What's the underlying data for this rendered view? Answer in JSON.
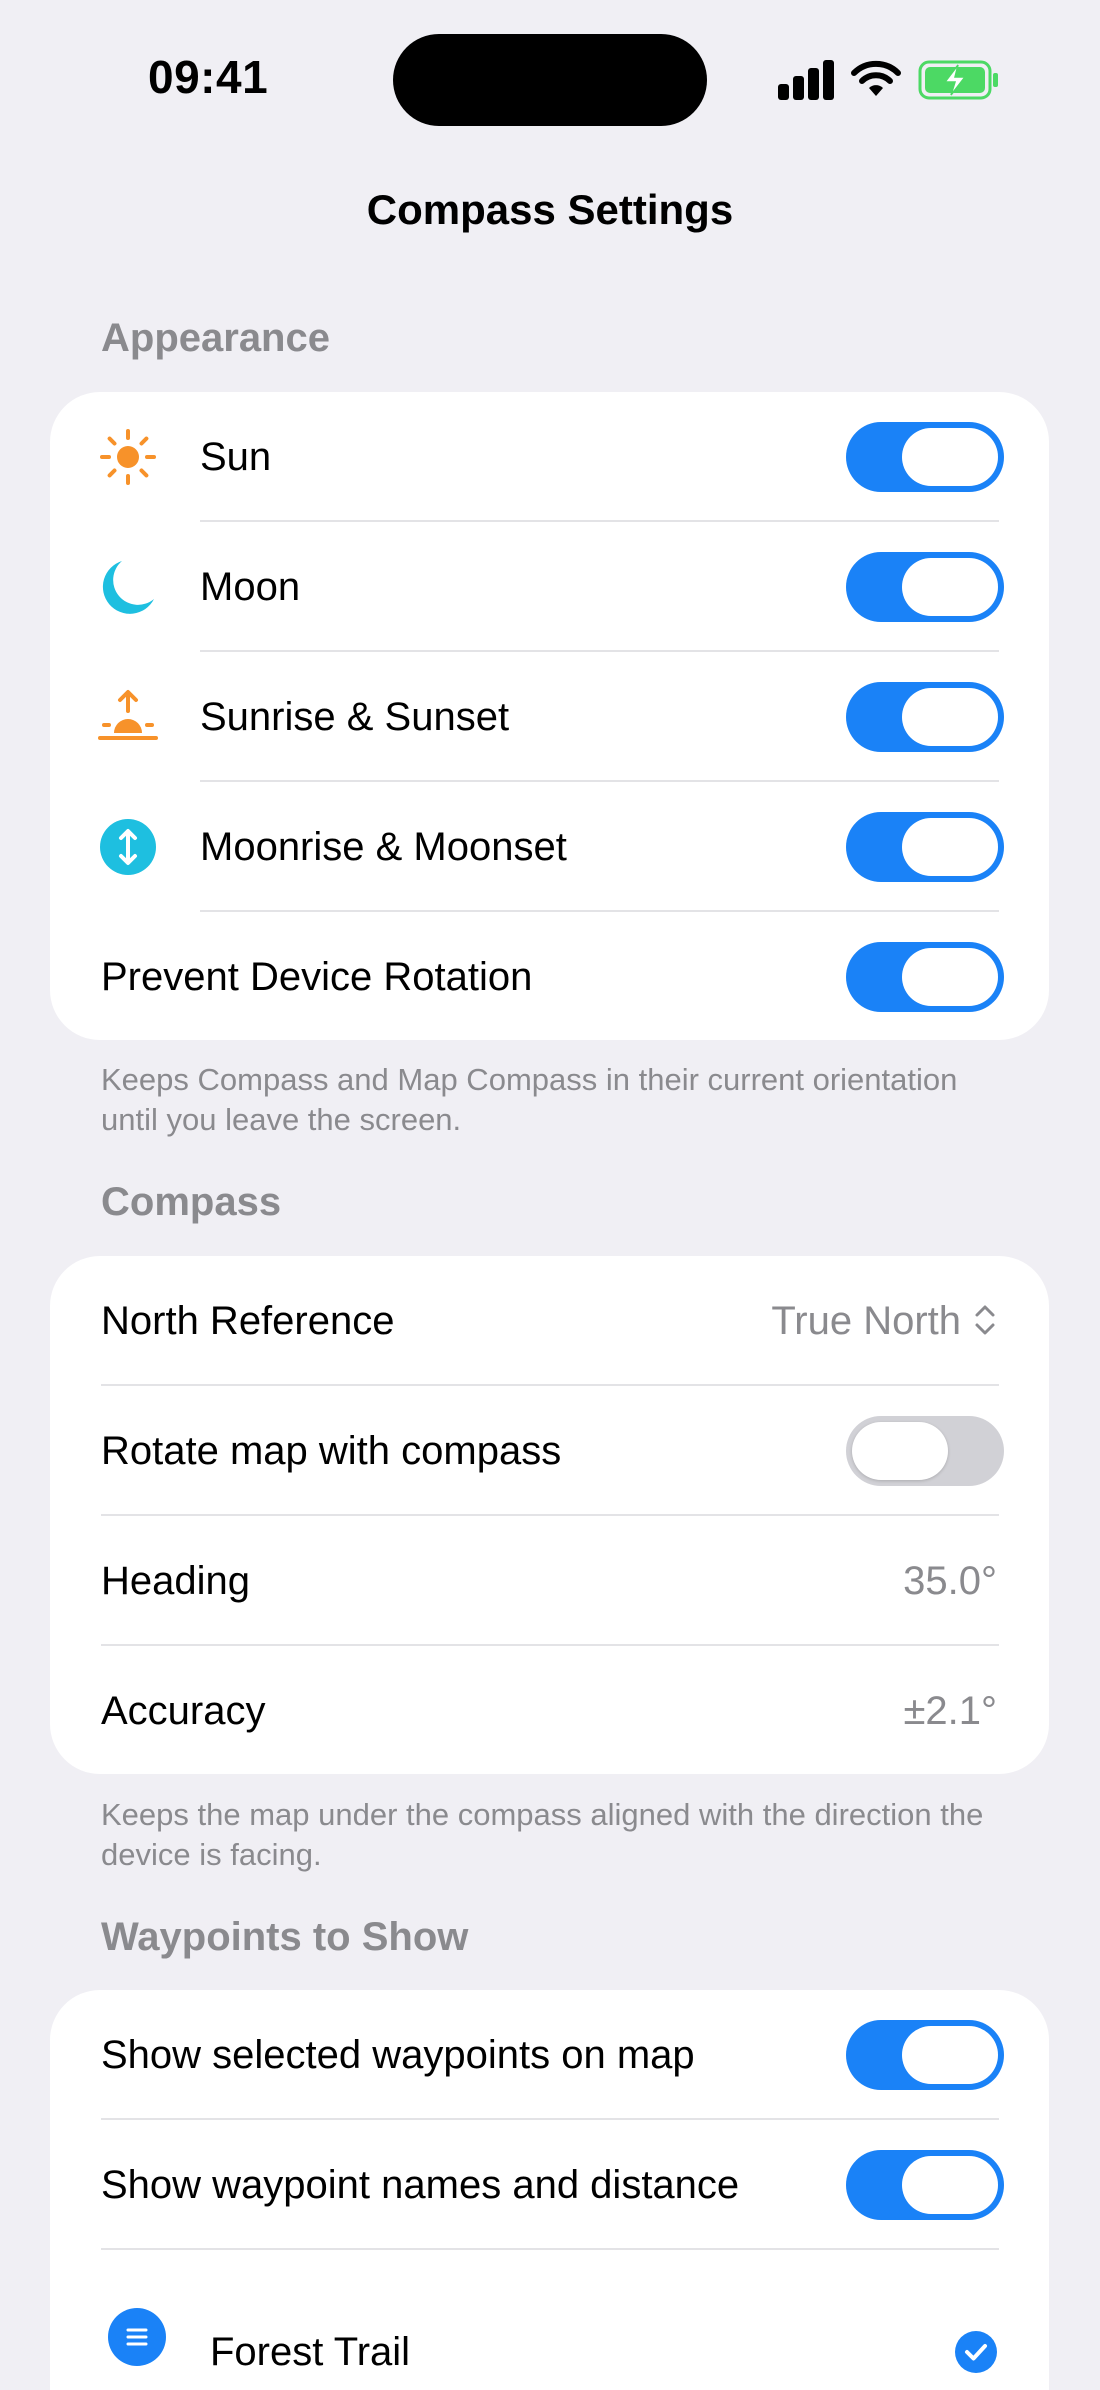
{
  "status_bar": {
    "time": "09:41"
  },
  "nav": {
    "title": "Compass Settings"
  },
  "appearance": {
    "header": "Appearance",
    "rows": [
      {
        "label": "Sun",
        "icon": "sun-icon",
        "toggle": true
      },
      {
        "label": "Moon",
        "icon": "moon-icon",
        "toggle": true
      },
      {
        "label": "Sunrise & Sunset",
        "icon": "sunrise-icon",
        "toggle": true
      },
      {
        "label": "Moonrise & Moonset",
        "icon": "moonrise-icon",
        "toggle": true
      },
      {
        "label": "Prevent Device Rotation",
        "toggle": true
      }
    ],
    "footer": "Keeps Compass and Map Compass in their current orientation until you leave the screen."
  },
  "compass": {
    "header": "Compass",
    "north_reference_label": "North Reference",
    "north_reference_value": "True North",
    "rotate_map_label": "Rotate map with compass",
    "rotate_map_toggle": false,
    "heading_label": "Heading",
    "heading_value": "35.0°",
    "accuracy_label": "Accuracy",
    "accuracy_value": "±2.1°",
    "footer": "Keeps the map under the compass aligned with the direction the device is facing."
  },
  "waypoints": {
    "header": "Waypoints to Show",
    "show_selected_label": "Show selected waypoints on map",
    "show_selected_toggle": true,
    "show_names_label": "Show waypoint names and distance",
    "show_names_toggle": true,
    "items": [
      {
        "name": "Forest Trail",
        "checked": true
      }
    ]
  },
  "colors": {
    "accent": "#1a82f7",
    "sun": "#f7922a",
    "moon": "#1ebfe0",
    "background": "#f0eff4",
    "secondary_text": "#8a8a8e",
    "battery": "#4cd964"
  }
}
